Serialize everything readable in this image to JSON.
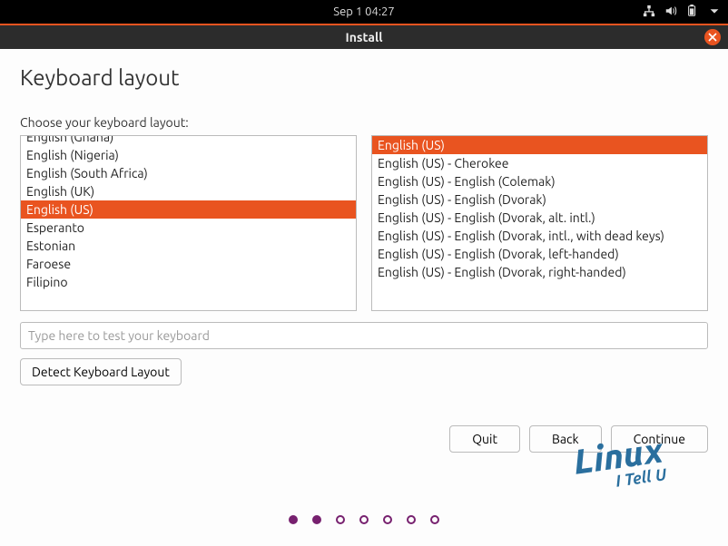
{
  "topbar": {
    "datetime": "Sep 1  04:27"
  },
  "titlebar": {
    "title": "Install"
  },
  "page": {
    "heading": "Keyboard layout",
    "instruction": "Choose your keyboard layout:",
    "left_list": [
      "English (Ghana)",
      "English (Nigeria)",
      "English (South Africa)",
      "English (UK)",
      "English (US)",
      "Esperanto",
      "Estonian",
      "Faroese",
      "Filipino"
    ],
    "left_selected_index": 4,
    "right_list": [
      "English (US)",
      "English (US) - Cherokee",
      "English (US) - English (Colemak)",
      "English (US) - English (Dvorak)",
      "English (US) - English (Dvorak, alt. intl.)",
      "English (US) - English (Dvorak, intl., with dead keys)",
      "English (US) - English (Dvorak, left-handed)",
      "English (US) - English (Dvorak, right-handed)"
    ],
    "right_selected_index": 0,
    "test_placeholder": "Type here to test your keyboard",
    "buttons": {
      "detect": "Detect Keyboard Layout",
      "quit": "Quit",
      "back": "Back",
      "continue": "Continue"
    }
  },
  "progress": {
    "total": 7,
    "filled": 2
  },
  "watermark": {
    "line1": "Linux",
    "line2": "I Tell U"
  }
}
